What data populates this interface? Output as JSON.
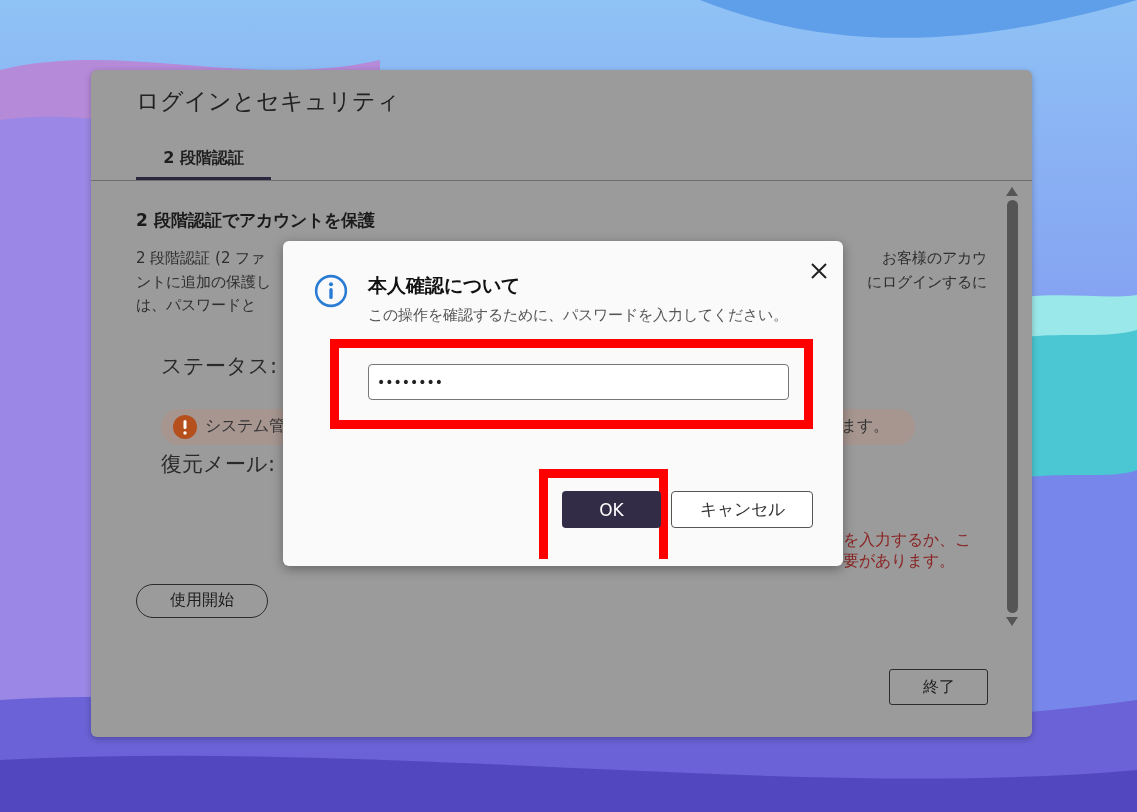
{
  "window": {
    "title": "ログインとセキュリティ"
  },
  "tabs": [
    {
      "label": "2 段階認証",
      "selected": true
    }
  ],
  "content": {
    "heading": "2 段階認証でアカウントを保護",
    "paragraph_lines": [
      {
        "left": "2 段階認証 (2 ファ",
        "right": "お客様のアカウ"
      },
      {
        "left": "ントに追加の保護し",
        "right": "にログインするに"
      },
      {
        "left": "は、パスワードと"
      }
    ],
    "status_label": "ステータス:",
    "notice": {
      "left": "システム管",
      "right": "ます。"
    },
    "recovery_label": "復元メール:",
    "warning_lines": [
      "を入力するか、こ",
      "要があります。"
    ],
    "start_button": "使用開始"
  },
  "footer": {
    "close_button": "終了"
  },
  "dialog": {
    "title": "本人確認について",
    "message": "この操作を確認するために、パスワードを入力してください。",
    "password": {
      "value": "••••••••"
    },
    "buttons": [
      {
        "label": "OK",
        "kind": "primary"
      },
      {
        "label": "キャンセル",
        "kind": "secondary"
      }
    ]
  }
}
